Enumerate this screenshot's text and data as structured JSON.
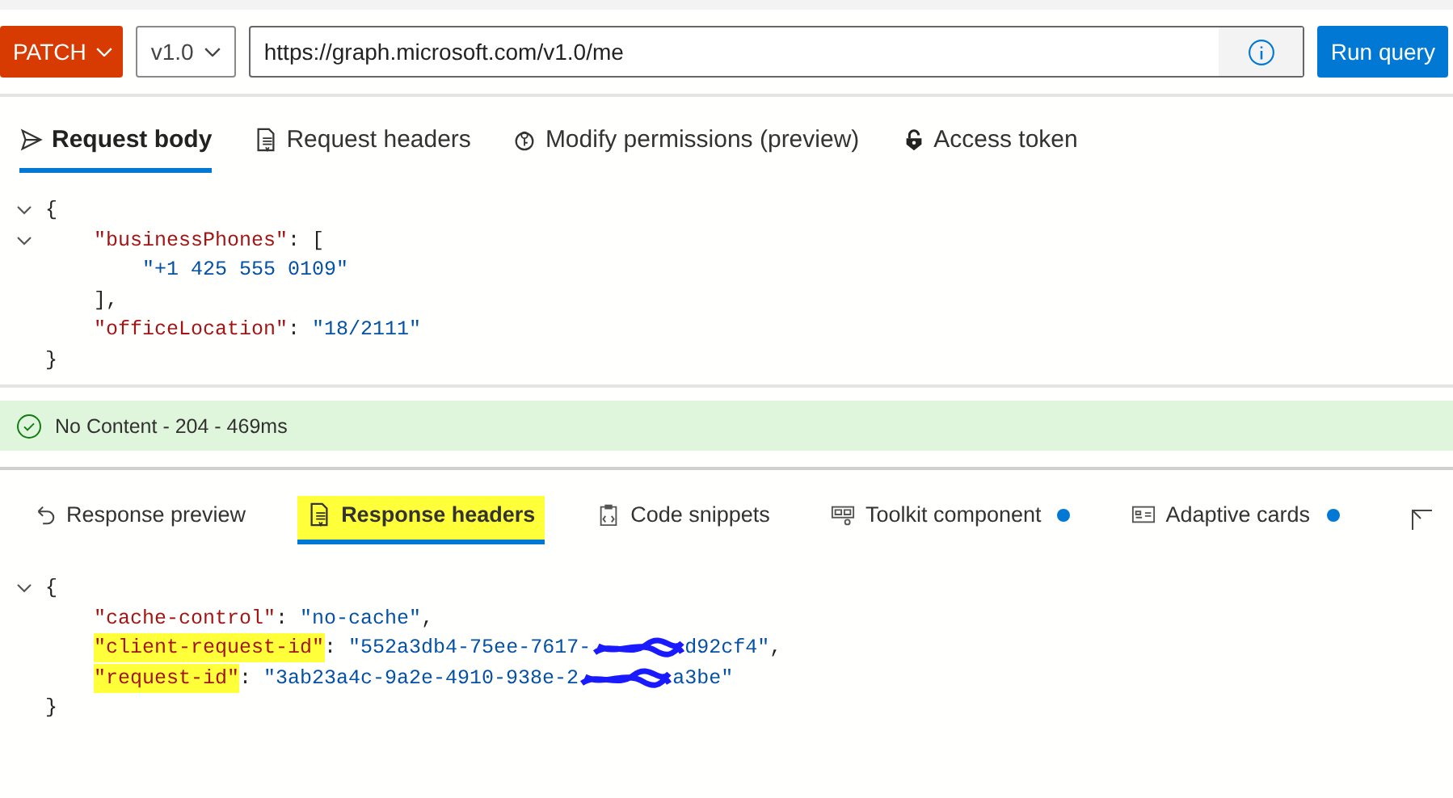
{
  "toolbar": {
    "method": "PATCH",
    "version": "v1.0",
    "url": "https://graph.microsoft.com/v1.0/me",
    "run_button": "Run query"
  },
  "request_tabs": [
    {
      "label": "Request body",
      "selected": true
    },
    {
      "label": "Request headers",
      "selected": false
    },
    {
      "label": "Modify permissions (preview)",
      "selected": false
    },
    {
      "label": "Access token",
      "selected": false
    }
  ],
  "request_body": [
    {
      "foldable": true,
      "tokens": [
        {
          "kind": "punct",
          "text": "{"
        }
      ],
      "children": [
        {
          "foldable": true,
          "tokens": [
            {
              "kind": "key",
              "text": "\"businessPhones\""
            },
            {
              "kind": "punct",
              "text": ": ["
            }
          ],
          "children": [
            {
              "foldable": false,
              "tokens": [
                {
                  "kind": "string",
                  "text": "\"+1 425 555 0109\""
                }
              ]
            }
          ]
        },
        {
          "foldable": false,
          "tokens": [
            {
              "kind": "punct",
              "text": "],"
            }
          ]
        },
        {
          "foldable": false,
          "tokens": [
            {
              "kind": "key",
              "text": "\"officeLocation\""
            },
            {
              "kind": "punct",
              "text": ": "
            },
            {
              "kind": "string",
              "text": "\"18/2111\""
            }
          ]
        }
      ]
    },
    {
      "foldable": false,
      "tokens": [
        {
          "kind": "punct",
          "text": "}"
        }
      ]
    }
  ],
  "status": {
    "text": "No Content - 204 - 469ms",
    "success": true
  },
  "response_tabs": [
    {
      "label": "Response preview",
      "selected": false,
      "highlighted": false,
      "badge": false
    },
    {
      "label": "Response headers",
      "selected": true,
      "highlighted": true,
      "badge": false
    },
    {
      "label": "Code snippets",
      "selected": false,
      "highlighted": false,
      "badge": false
    },
    {
      "label": "Toolkit component",
      "selected": false,
      "highlighted": false,
      "badge": true
    },
    {
      "label": "Adaptive cards",
      "selected": false,
      "highlighted": false,
      "badge": true
    }
  ],
  "response_body": [
    {
      "foldable": true,
      "tokens": [
        {
          "kind": "punct",
          "text": "{"
        }
      ],
      "children": [
        {
          "foldable": false,
          "tokens": [
            {
              "kind": "key",
              "text": "\"cache-control\"",
              "highlighted": false
            },
            {
              "kind": "punct",
              "text": ": "
            },
            {
              "kind": "string",
              "text": "\"no-cache\""
            },
            {
              "kind": "punct",
              "text": ","
            }
          ]
        },
        {
          "foldable": false,
          "tokens": [
            {
              "kind": "key",
              "text": "\"client-request-id\"",
              "highlighted": true
            },
            {
              "kind": "punct",
              "text": ": "
            },
            {
              "kind": "string",
              "text": "\"552a3db4-75ee-7617-"
            },
            {
              "kind": "redacted"
            },
            {
              "kind": "string",
              "text": "d92cf4\""
            },
            {
              "kind": "punct",
              "text": ","
            }
          ]
        },
        {
          "foldable": false,
          "tokens": [
            {
              "kind": "key",
              "text": "\"request-id\"",
              "highlighted": true
            },
            {
              "kind": "punct",
              "text": ": "
            },
            {
              "kind": "string",
              "text": "\"3ab23a4c-9a2e-4910-938e-2"
            },
            {
              "kind": "redacted"
            },
            {
              "kind": "string",
              "text": "a3be\""
            }
          ]
        }
      ]
    },
    {
      "foldable": false,
      "tokens": [
        {
          "kind": "punct",
          "text": "}"
        }
      ]
    }
  ]
}
